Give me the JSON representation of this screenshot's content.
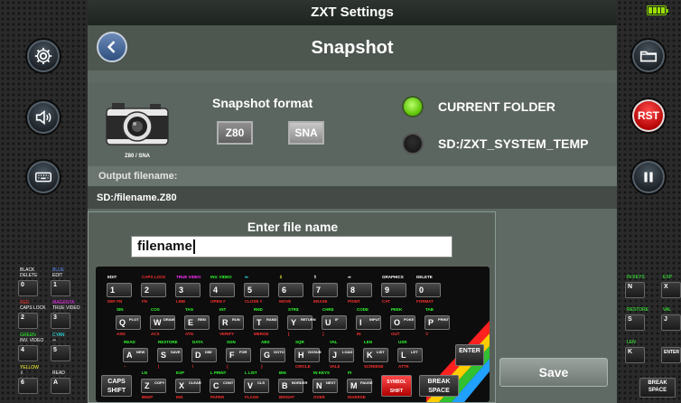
{
  "window": {
    "title": "ZXT Settings"
  },
  "header": {
    "title": "Snapshot"
  },
  "camera": {
    "caption": "Z80 / SNA"
  },
  "snapshot_format": {
    "label": "Snapshot format",
    "options": [
      "Z80",
      "SNA"
    ],
    "selected": "Z80"
  },
  "folder_options": [
    {
      "label": "CURRENT FOLDER",
      "selected": true
    },
    {
      "label": "SD:/ZXT_SYSTEM_TEMP",
      "selected": false
    }
  ],
  "output": {
    "label": "Output filename:",
    "value": "SD:/filename.Z80"
  },
  "dialog": {
    "title": "Enter file name",
    "value": "filename"
  },
  "save_label": "Save",
  "side_buttons": {
    "rst_label": "RST"
  },
  "keyboard": {
    "row1": [
      {
        "k": "1",
        "top": "EDIT",
        "bot": "DEF FN",
        "tc": "#ffffff"
      },
      {
        "k": "2",
        "top": "CAPS LOCK",
        "bot": "FN",
        "tc": "#ff3030"
      },
      {
        "k": "3",
        "top": "TRUE VIDEO",
        "bot": "LINE",
        "tc": "#ff30ff"
      },
      {
        "k": "4",
        "top": "INV. VIDEO",
        "bot": "OPEN #",
        "tc": "#30ff30"
      },
      {
        "k": "5",
        "top": "⇦",
        "bot": "CLOSE #",
        "tc": "#30ffff"
      },
      {
        "k": "6",
        "top": "⇩",
        "bot": "MOVE",
        "tc": "#ffff30"
      },
      {
        "k": "7",
        "top": "⇧",
        "bot": "ERASE",
        "tc": "#ffffff"
      },
      {
        "k": "8",
        "top": "⇨",
        "bot": "POINT",
        "tc": "#ffffff"
      },
      {
        "k": "9",
        "top": "GRAPHICS",
        "bot": "CAT",
        "tc": "#ffffff"
      },
      {
        "k": "0",
        "top": "DELETE",
        "bot": "FORMAT",
        "tc": "#ffffff"
      }
    ],
    "row2": [
      {
        "k": "Q",
        "w": "PLOT",
        "top": "SIN",
        "bot": "ASN"
      },
      {
        "k": "W",
        "w": "DRAW",
        "top": "COS",
        "bot": "ACS"
      },
      {
        "k": "E",
        "w": "REM",
        "top": "TAN",
        "bot": "ATN"
      },
      {
        "k": "R",
        "w": "RUN",
        "top": "INT",
        "bot": "VERIFY"
      },
      {
        "k": "T",
        "w": "RAND",
        "top": "RND",
        "bot": "MERGE"
      },
      {
        "k": "Y",
        "w": "RETURN",
        "top": "STR$",
        "bot": "["
      },
      {
        "k": "U",
        "w": "IF",
        "top": "CHR$",
        "bot": "]"
      },
      {
        "k": "I",
        "w": "INPUT",
        "top": "CODE",
        "bot": "IN"
      },
      {
        "k": "O",
        "w": "POKE",
        "top": "PEEK",
        "bot": "OUT"
      },
      {
        "k": "P",
        "w": "PRINT",
        "top": "TAB",
        "bot": "©"
      }
    ],
    "row3": [
      {
        "k": "A",
        "w": "NEW",
        "top": "READ",
        "bot": "~"
      },
      {
        "k": "S",
        "w": "SAVE",
        "top": "RESTORE",
        "bot": "|"
      },
      {
        "k": "D",
        "w": "DIM",
        "top": "DATA",
        "bot": "\\"
      },
      {
        "k": "F",
        "w": "FOR",
        "top": "SGN",
        "bot": "{"
      },
      {
        "k": "G",
        "w": "GOTO",
        "top": "ABS",
        "bot": "}"
      },
      {
        "k": "H",
        "w": "GOSUB",
        "top": "SQR",
        "bot": "CIRCLE"
      },
      {
        "k": "J",
        "w": "LOAD",
        "top": "VAL",
        "bot": "VAL$"
      },
      {
        "k": "K",
        "w": "LIST",
        "top": "LEN",
        "bot": "SCREEN$"
      },
      {
        "k": "L",
        "w": "LET",
        "top": "USR",
        "bot": "ATTR"
      }
    ],
    "enter": "ENTER",
    "row4": [
      {
        "k": "Z",
        "w": "COPY",
        "top": "LN",
        "bot": "BEEP"
      },
      {
        "k": "X",
        "w": "CLEAR",
        "top": "EXP",
        "bot": "INK"
      },
      {
        "k": "C",
        "w": "CONT",
        "top": "L PRINT",
        "bot": "PAPER"
      },
      {
        "k": "V",
        "w": "CLS",
        "top": "L LIST",
        "bot": "FLASH"
      },
      {
        "k": "B",
        "w": "BORDER",
        "top": "BIN",
        "bot": "BRIGHT"
      },
      {
        "k": "N",
        "w": "NEXT",
        "top": "IN KEYS",
        "bot": "OVER"
      },
      {
        "k": "M",
        "w": "PAUSE",
        "top": "PI",
        "bot": "INVERSE"
      }
    ],
    "caps_shift": "CAPS SHIFT",
    "symbol_shift": "SYMBOL SHIFT",
    "break_space": "BREAK SPACE"
  },
  "side_keys_left": [
    {
      "k": "0",
      "top": "DELETE",
      "top2": "BLACK"
    },
    {
      "k": "1",
      "top": "EDIT",
      "top2": "BLUE"
    },
    {
      "k": "2",
      "top": "CAPS LOCK",
      "top2": "RED"
    },
    {
      "k": "3",
      "top": "TRUE VIDEO",
      "top2": "MAGENTA"
    },
    {
      "k": "4",
      "top": "INV. VIDEO",
      "top2": "GREEN"
    },
    {
      "k": "5",
      "top": "⇦",
      "top2": "CYAN"
    },
    {
      "k": "6",
      "top": "⇩",
      "top2": "YELLOW"
    },
    {
      "k": "A",
      "top": "READ",
      "top2": ""
    }
  ],
  "side_keys_right": [
    {
      "k": "N",
      "top": "IN KEYS"
    },
    {
      "k": "X",
      "top": "EXP"
    },
    {
      "k": "S",
      "top": "RESTORE"
    },
    {
      "k": "J",
      "top": "VAL"
    },
    {
      "k": "K",
      "top": "LEN"
    },
    {
      "k": "ENTER",
      "top": ""
    },
    {
      "k": "BREAK SPACE",
      "top": ""
    }
  ]
}
